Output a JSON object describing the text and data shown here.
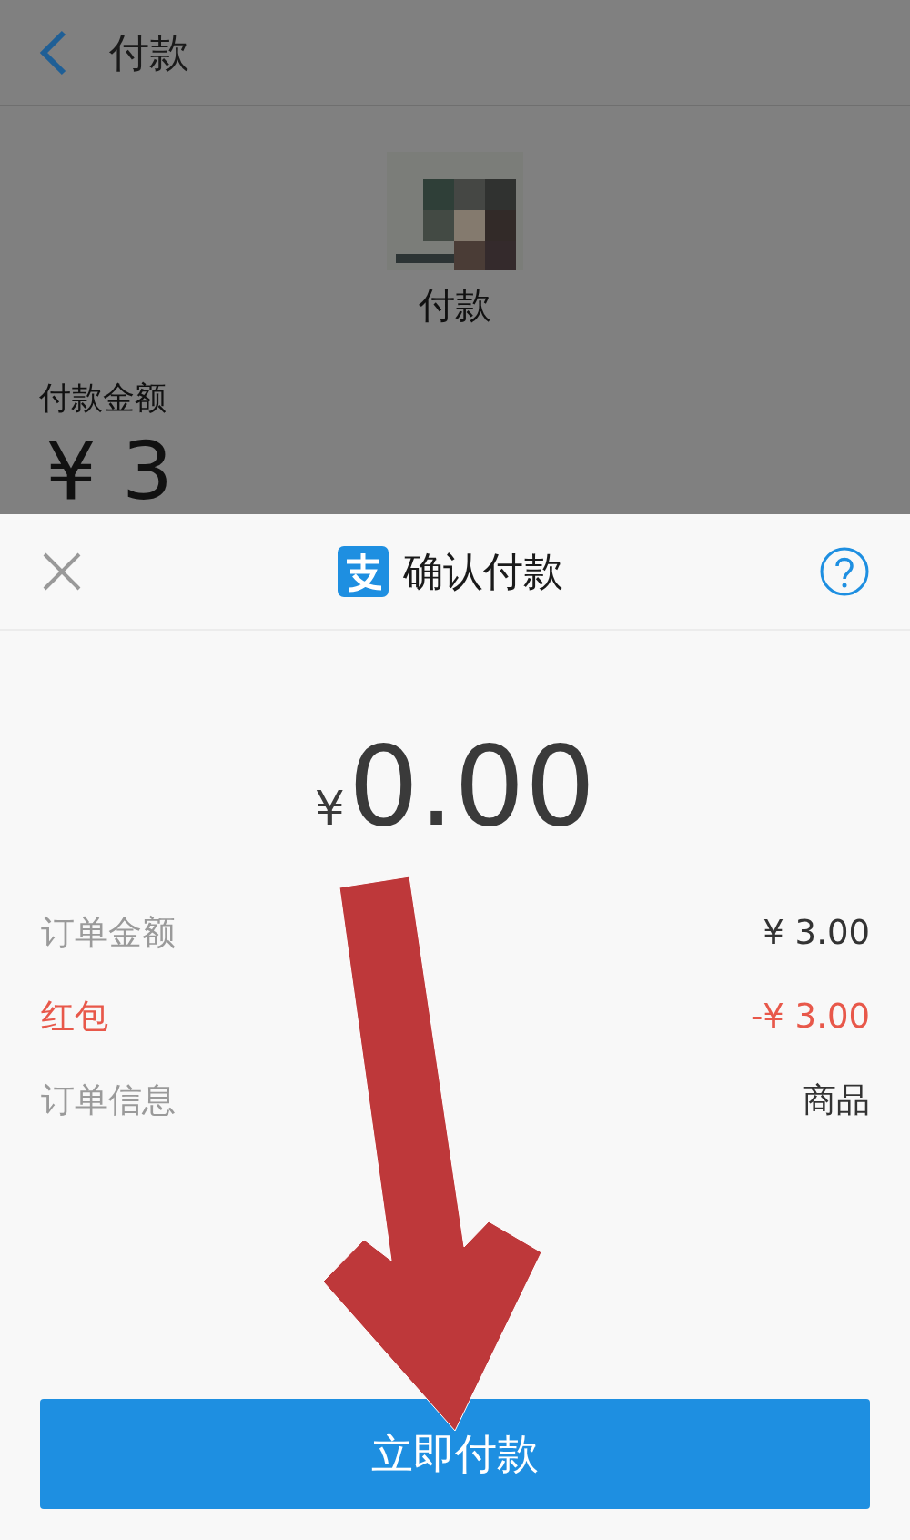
{
  "background_page": {
    "title": "付款",
    "payee_caption": "付款",
    "amount_label": "付款金额",
    "amount": "¥ 3"
  },
  "sheet": {
    "title": "确认付款",
    "currency": "¥",
    "amount": "0.00",
    "rows": [
      {
        "label": "订单金额",
        "value": "¥ 3.00",
        "kind": "normal"
      },
      {
        "label": "红包",
        "value": "-¥ 3.00",
        "kind": "discount"
      },
      {
        "label": "订单信息",
        "value": "商品",
        "kind": "normal"
      }
    ],
    "button": "立即付款"
  }
}
